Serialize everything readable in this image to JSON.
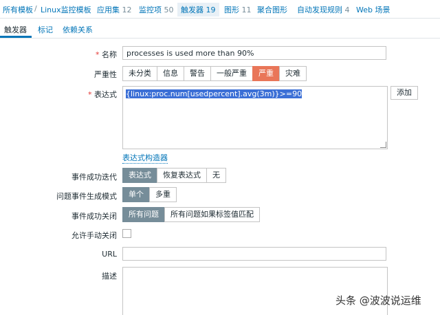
{
  "topnav": {
    "all_templates": "所有模板",
    "sep": "/",
    "template": "Linux监控模板",
    "apps_label": "应用集",
    "apps_count": "12",
    "items_label": "监控项",
    "items_count": "50",
    "triggers_label": "触发器",
    "triggers_count": "19",
    "graphs_label": "图形",
    "graphs_count": "11",
    "screens_label": "聚合图形",
    "discovery_label": "自动发现规则",
    "discovery_count": "4",
    "web_label": "Web 场景"
  },
  "subtabs": {
    "trigger": "触发器",
    "tags": "标记",
    "deps": "依赖关系"
  },
  "form": {
    "name_label": "名称",
    "required_mark": "*",
    "name_value": "processes is used more than 90%",
    "severity_label": "严重性",
    "severities": [
      "未分类",
      "信息",
      "警告",
      "一般严重",
      "严重",
      "灾难"
    ],
    "severity_selected": "严重",
    "expression_label": "表达式",
    "expression_value": "{linux:proc.num[usedpercent].avg(3m)}>=90",
    "add_button": "添加",
    "expression_builder": "表达式构造器",
    "ok_event_gen_label": "事件成功迭代",
    "ok_event_gen_options": [
      "表达式",
      "恢复表达式",
      "无"
    ],
    "problem_mode_label": "问题事件生成模式",
    "problem_mode_options": [
      "单个",
      "多重"
    ],
    "ok_close_label": "事件成功关闭",
    "ok_close_options": [
      "所有问题",
      "所有问题如果标签值匹配"
    ],
    "manual_close_label": "允许手动关闭",
    "url_label": "URL",
    "url_value": "",
    "description_label": "描述",
    "description_value": ""
  },
  "watermark": "头条 @波波说运维",
  "colors": {
    "link": "#0275b8",
    "selected_grey": "#768d99",
    "selected_red": "#e97659",
    "required": "#e33734"
  }
}
